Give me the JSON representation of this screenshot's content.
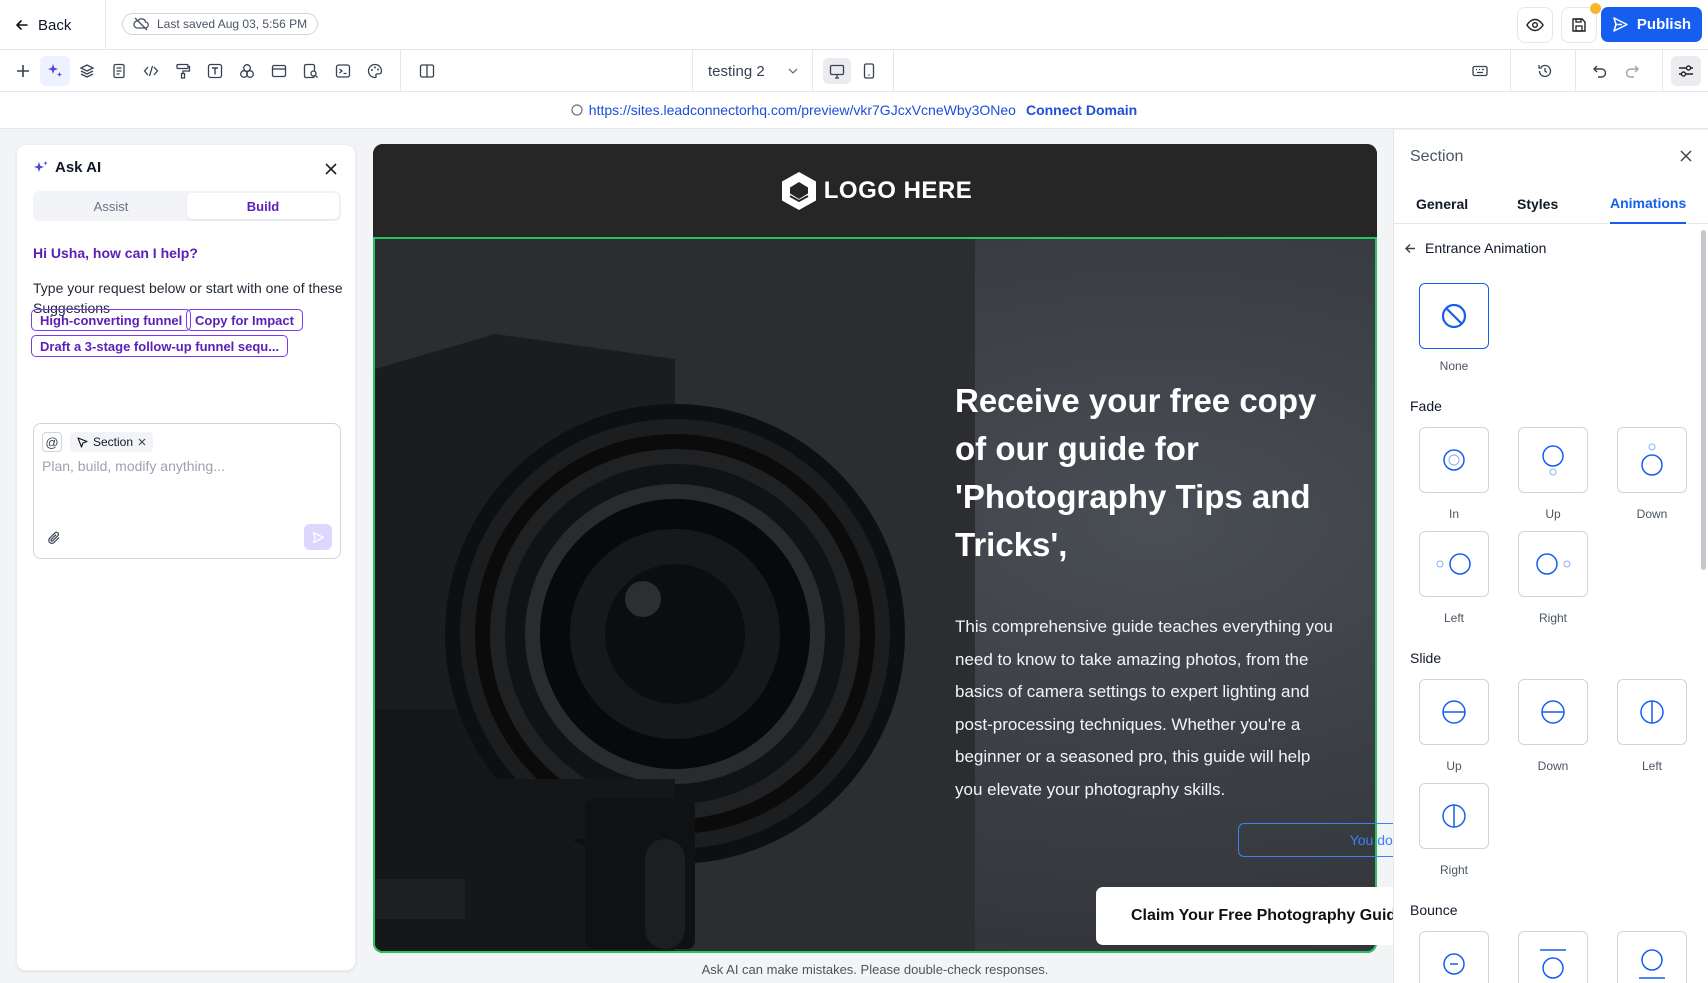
{
  "topbar": {
    "back_label": "Back",
    "last_saved": "Last saved Aug 03, 5:56 PM",
    "publish_label": "Publish"
  },
  "toolbar": {
    "page_name": "testing 2"
  },
  "urlbar": {
    "preview_url": "https://sites.leadconnectorhq.com/preview/vkr7GJcxVcneWby3ONeo",
    "connect_domain": "Connect Domain"
  },
  "ai_panel": {
    "title": "Ask AI",
    "tabs": [
      "Assist",
      "Build"
    ],
    "active_tab": "Build",
    "greeting": "Hi Usha, how can I help?",
    "subtitle": "Type your request below or start with one of these Suggestions",
    "suggestions": [
      "High-converting funnel",
      "Copy for Impact",
      "Draft a 3-stage follow-up funnel sequ..."
    ],
    "at_symbol": "@",
    "context_tag": "Section",
    "placeholder": "Plan, build, modify anything...",
    "disclaimer": "Ask AI can make mistakes. Please double-check responses."
  },
  "canvas": {
    "logo_text": "LOGO HERE",
    "hero_title": "Receive your free copy of our guide for 'Photography Tips and Tricks',",
    "hero_body": "This comprehensive guide teaches everything you need to know to take amazing photos, from the basics of camera settings to expert lighting and post-processing techniques. Whether you're a beginner or a seasoned pro, this guide will help you elevate your photography skills.",
    "form_empty": "You do not have any forms yet",
    "cta_label": "Claim Your Free Photography Guide"
  },
  "right_panel": {
    "title": "Section",
    "tabs": [
      "General",
      "Styles",
      "Animations"
    ],
    "active_tab": "Animations",
    "back_label": "Entrance Animation",
    "none_label": "None",
    "groups": {
      "fade": {
        "title": "Fade",
        "items": [
          "In",
          "Up",
          "Down",
          "Left",
          "Right"
        ]
      },
      "slide": {
        "title": "Slide",
        "items": [
          "Up",
          "Down",
          "Left",
          "Right"
        ]
      },
      "bounce": {
        "title": "Bounce"
      }
    }
  },
  "colors": {
    "accent": "#155eef",
    "ai_purple": "#5b21b6",
    "selection_green": "#22c55e",
    "badge_yellow": "#f5b72b"
  }
}
